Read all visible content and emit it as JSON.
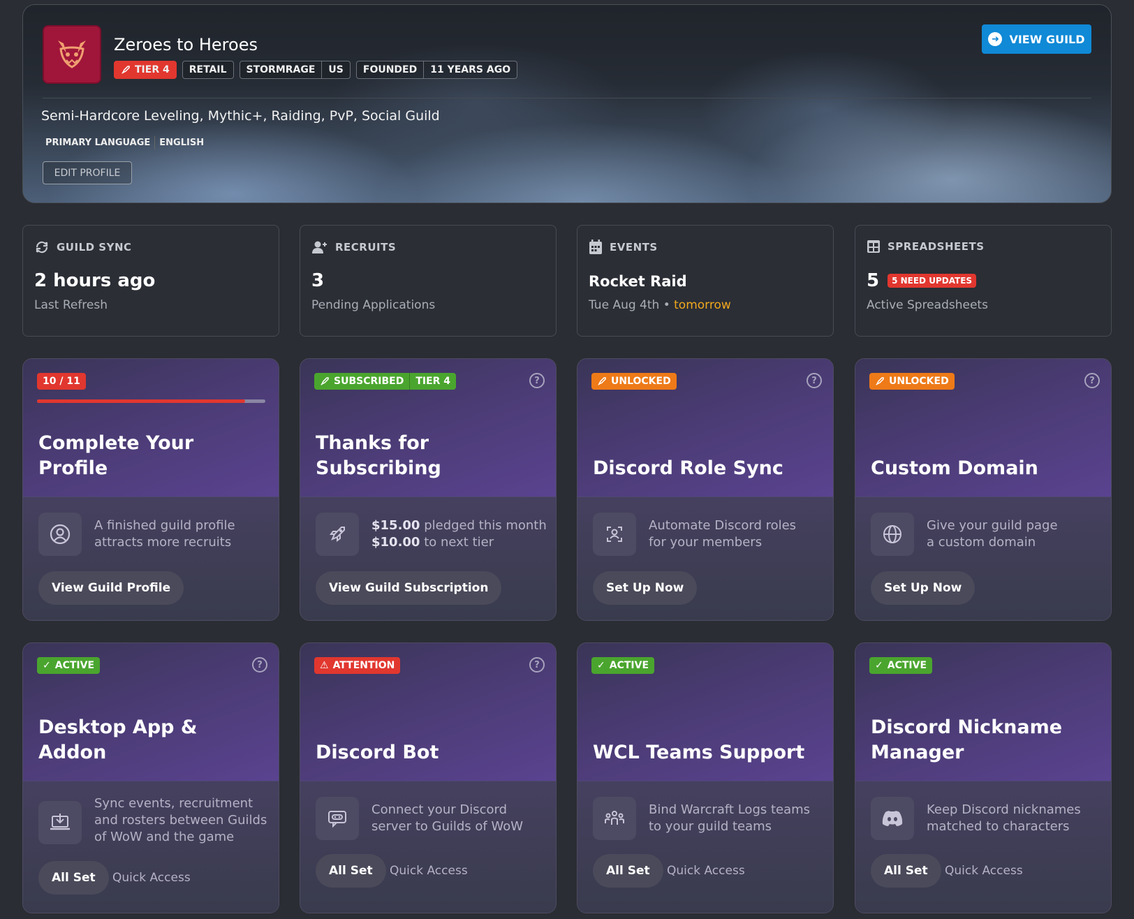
{
  "hero": {
    "name": "Zeroes to Heroes",
    "tier_label": "TIER 4",
    "tags": {
      "retail": "RETAIL",
      "realm": "STORMRAGE",
      "region": "US",
      "founded_label": "FOUNDED",
      "founded_value": "11 YEARS AGO"
    },
    "description": "Semi-Hardcore Leveling, Mythic+, Raiding, PvP, Social Guild",
    "language_label": "PRIMARY LANGUAGE",
    "language_value": "ENGLISH",
    "edit_profile": "EDIT PROFILE",
    "view_guild": "VIEW GUILD"
  },
  "stats": [
    {
      "label": "GUILD SYNC",
      "value": "2 hours ago",
      "sub": "Last Refresh"
    },
    {
      "label": "RECRUITS",
      "value": "3",
      "sub": "Pending Applications"
    },
    {
      "label": "EVENTS",
      "value": "Rocket Raid",
      "sub": "Tue Aug 4th",
      "sub_sep": "•",
      "sub_highlight": "tomorrow"
    },
    {
      "label": "SPREADSHEETS",
      "value": "5",
      "badge": "5 NEED UPDATES",
      "sub": "Active Spreadsheets"
    }
  ],
  "cards": [
    {
      "badge": "10 / 11",
      "progress": 0.91,
      "title": "Complete Your Profile",
      "desc_line1": "A finished guild profile",
      "desc_line2": "attracts more recruits",
      "button": "View Guild Profile"
    },
    {
      "badge": "SUBSCRIBED",
      "badge2": "TIER 4",
      "title": "Thanks for Subscribing",
      "amount1": "$15.00",
      "desc_line1": " pledged this month",
      "amount2": "$10.00",
      "desc_line2": " to next tier",
      "button": "View Guild Subscription"
    },
    {
      "badge": "UNLOCKED",
      "title": "Discord Role Sync",
      "desc_line1": "Automate Discord roles",
      "desc_line2": "for your members",
      "button": "Set Up Now"
    },
    {
      "badge": "UNLOCKED",
      "title": "Custom Domain",
      "desc_line1": "Give your guild page",
      "desc_line2": "a custom domain",
      "button": "Set Up Now"
    },
    {
      "badge": "ACTIVE",
      "title": "Desktop App & Addon",
      "desc_line1": "Sync events, recruitment",
      "desc_line2": "and rosters between Guilds",
      "desc_line3": "of WoW and the game",
      "button": "All Set",
      "quick": "Quick Access"
    },
    {
      "badge": "ATTENTION",
      "title": "Discord Bot",
      "desc_line1": "Connect your Discord",
      "desc_line2": "server to Guilds of WoW",
      "button": "All Set",
      "quick": "Quick Access"
    },
    {
      "badge": "ACTIVE",
      "title": "WCL Teams Support",
      "desc_line1": "Bind Warcraft Logs teams",
      "desc_line2": "to your guild teams",
      "button": "All Set",
      "quick": "Quick Access"
    },
    {
      "badge": "ACTIVE",
      "title_line1": "Discord Nickname",
      "title_line2": "Manager",
      "desc_line1": "Keep Discord nicknames",
      "desc_line2": "matched to characters",
      "button": "All Set",
      "quick": "Quick Access"
    }
  ],
  "help_glyph": "?",
  "colors": {
    "accent": "#1089d6",
    "danger": "#e1372f",
    "success": "#4aa52e",
    "warning": "#ee7a18",
    "highlight": "#f1a81e"
  }
}
